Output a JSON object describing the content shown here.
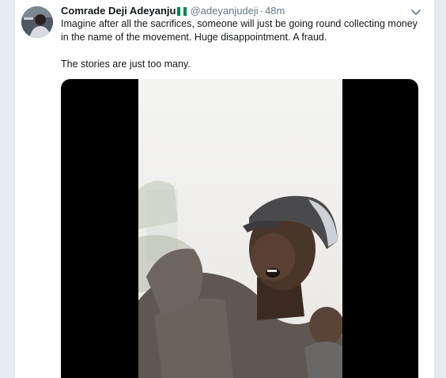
{
  "tweet": {
    "author_name": "Comrade Deji Adeyanju",
    "author_handle": "@adeyanjudeji",
    "separator": "·",
    "timestamp": "48m",
    "paragraphs": [
      "Imagine after all the sacrifices, someone will just be going round collecting money in the name of the movement. Huge disappointment. A fraud.",
      "The stories are just too many."
    ],
    "icons": {
      "flag": "nigeria-flag-icon",
      "more": "chevron-down-icon"
    }
  },
  "colors": {
    "name": "#14171a",
    "secondary": "#657786",
    "accent": "#1da1f2",
    "flag_green": "#008751",
    "flag_white": "#ffffff",
    "media_bg": "#000000"
  }
}
